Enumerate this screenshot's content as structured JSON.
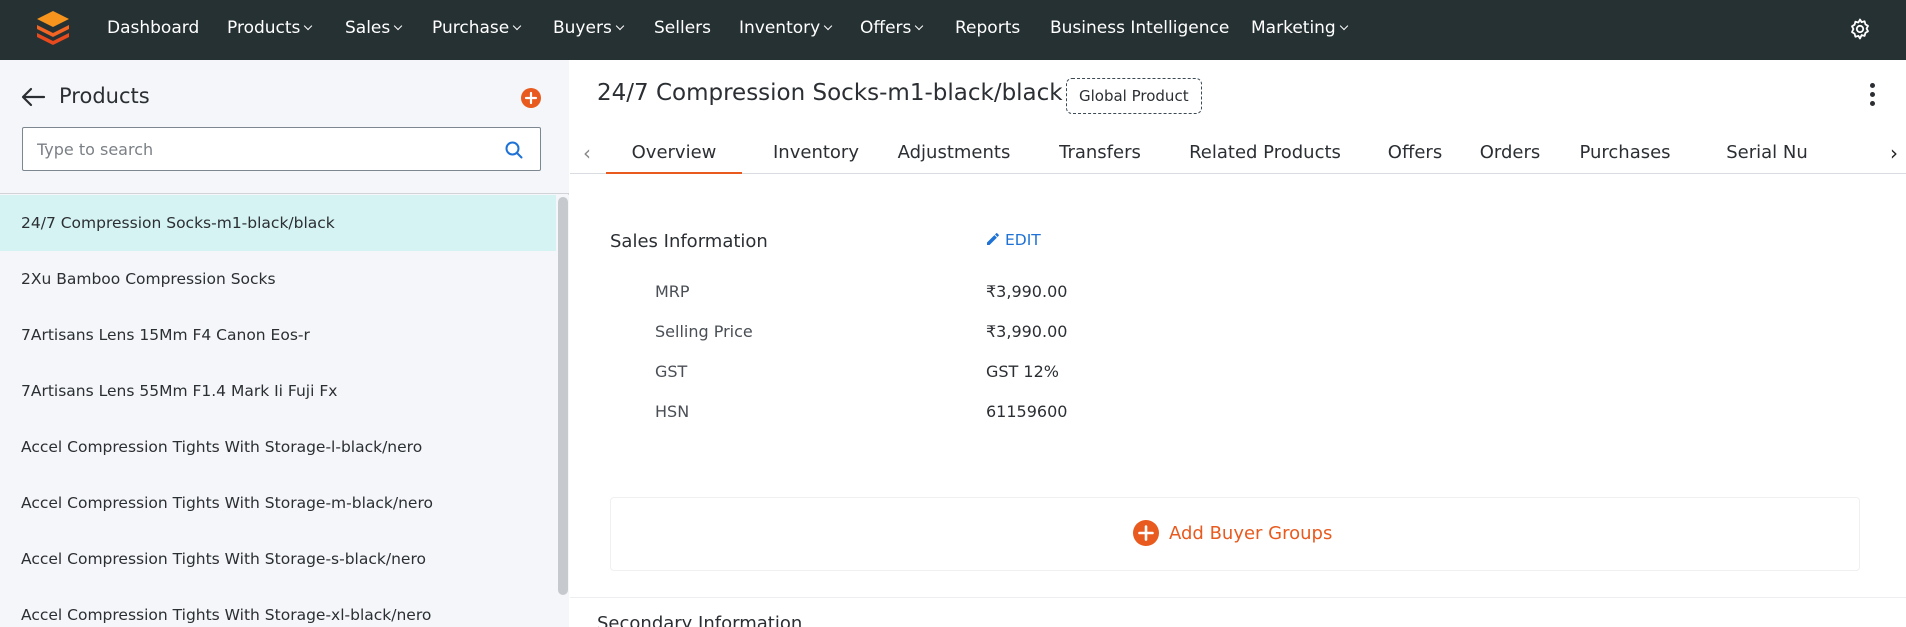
{
  "nav": {
    "items": [
      {
        "label": "Dashboard",
        "dropdown": false
      },
      {
        "label": "Products",
        "dropdown": true
      },
      {
        "label": "Sales",
        "dropdown": true
      },
      {
        "label": "Purchase",
        "dropdown": true
      },
      {
        "label": "Buyers",
        "dropdown": true
      },
      {
        "label": "Sellers",
        "dropdown": false
      },
      {
        "label": "Inventory",
        "dropdown": true
      },
      {
        "label": "Offers",
        "dropdown": true
      },
      {
        "label": "Reports",
        "dropdown": false
      },
      {
        "label": "Business Intelligence",
        "dropdown": false
      },
      {
        "label": "Marketing",
        "dropdown": true
      }
    ],
    "settings_icon": "gear-icon",
    "logo_icon": "stacked-layers-logo"
  },
  "sidebar": {
    "title": "Products",
    "search_placeholder": "Type to search",
    "items": [
      "24/7 Compression Socks-m1-black/black",
      "2Xu Bamboo Compression Socks",
      "7Artisans Lens 15Mm F4 Canon Eos-r",
      "7Artisans Lens 55Mm F1.4 Mark Ii Fuji Fx",
      "Accel Compression Tights With Storage-l-black/nero",
      "Accel Compression Tights With Storage-m-black/nero",
      "Accel Compression Tights With Storage-s-black/nero",
      "Accel Compression Tights With Storage-xl-black/nero"
    ],
    "selected_index": 0
  },
  "product": {
    "title": "24/7 Compression Socks-m1-black/black",
    "badge": "Global Product"
  },
  "tabs": [
    "Overview",
    "Inventory",
    "Adjustments",
    "Transfers",
    "Related Products",
    "Offers",
    "Orders",
    "Purchases",
    "Serial Nu"
  ],
  "active_tab": "Overview",
  "sales_info": {
    "title": "Sales Information",
    "edit_label": "EDIT",
    "rows": [
      {
        "label": "MRP",
        "value": "₹3,990.00"
      },
      {
        "label": "Selling Price",
        "value": "₹3,990.00"
      },
      {
        "label": "GST",
        "value": "GST 12%"
      },
      {
        "label": "HSN",
        "value": "61159600"
      }
    ],
    "add_buyer_groups_label": "Add Buyer Groups"
  },
  "secondary_info": {
    "title": "Secondary Information"
  },
  "colors": {
    "topbar_bg": "#263133",
    "accent_orange": "#e85a1e",
    "link_blue": "#1e72d6",
    "selected_row_bg": "#d6f3f3",
    "sidebar_bg": "#f4f6f9"
  }
}
